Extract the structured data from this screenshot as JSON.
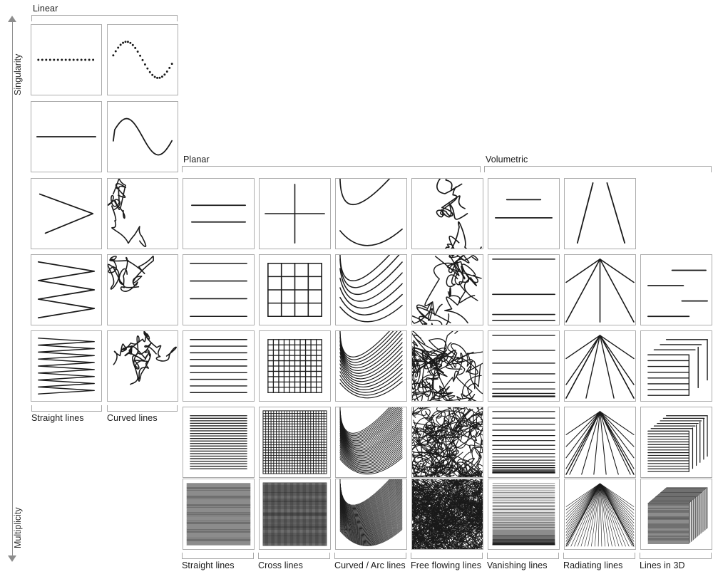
{
  "figure": {
    "title_axes": {
      "vertical_top": "Singularity",
      "vertical_bottom": "Multiplicity"
    },
    "top_groups": [
      {
        "id": "linear",
        "label": "Linear",
        "columns": [
          0,
          1
        ]
      },
      {
        "id": "planar",
        "label": "Planar",
        "columns": [
          2,
          3,
          4,
          5
        ]
      },
      {
        "id": "volumetric",
        "label": "Volumetric",
        "columns": [
          6,
          7,
          8
        ]
      }
    ],
    "column_labels_upper": [
      "Straight lines",
      "Curved lines"
    ],
    "column_labels_lower": [
      "Straight lines",
      "Cross lines",
      "Curved / Arc lines",
      "Free flowing lines",
      "Vanishing lines",
      "Radiating lines",
      "Lines in  3D"
    ],
    "colors": {
      "cell_border": "#acacac",
      "bracket": "#a8a8a8",
      "axis": "#8d8d8d",
      "stroke": "#1a1a1a",
      "text": "#1a1a1a",
      "background": "#ffffff"
    },
    "grid": {
      "columns": 9,
      "rows": 8,
      "linear_column_rows": [
        0,
        1,
        2,
        3,
        4
      ],
      "planar_column_rows": [
        2,
        3,
        4,
        5,
        6,
        7
      ],
      "volumetric_column_rows": [
        2,
        3,
        4,
        5,
        6,
        7
      ],
      "lines_in_3d_rows": [
        3,
        4,
        5,
        6,
        7
      ]
    },
    "cells": {
      "col0": {
        "name": "straight-lines-linear",
        "rows": [
          "dotted-straight",
          "single-straight",
          "zigzag-1",
          "zigzag-2",
          "zigzag-3"
        ]
      },
      "col1": {
        "name": "curved-lines-linear",
        "rows": [
          "dotted-wave",
          "single-wave",
          "squiggle-1",
          "squiggle-2",
          "squiggle-3"
        ]
      },
      "col2": {
        "name": "straight-lines-planar",
        "rows": [
          "parallel-2",
          "parallel-4",
          "parallel-8",
          "parallel-20",
          "parallel-40",
          "parallel-70"
        ]
      },
      "col3": {
        "name": "cross-lines-planar",
        "rows": [
          "cross-1",
          "grid-4",
          "grid-10",
          "grid-24",
          "grid-44",
          "grid-70"
        ]
      },
      "col4": {
        "name": "curved-arc-lines-planar",
        "rows": [
          "arc-2",
          "arc-6",
          "arc-14",
          "arc-30",
          "arc-55",
          "arc-90"
        ]
      },
      "col5": {
        "name": "free-flowing-lines-planar",
        "rows": [
          "flow-3",
          "flow-10",
          "flow-24",
          "flow-50",
          "flow-90",
          "flow-160"
        ]
      },
      "col6": {
        "name": "vanishing-lines-volumetric",
        "rows": [
          "vanish-2",
          "vanish-4",
          "vanish-8",
          "vanish-18",
          "vanish-34",
          "vanish-60"
        ]
      },
      "col7": {
        "name": "radiating-lines-volumetric",
        "rows": [
          "radiate-2",
          "radiate-4",
          "radiate-10",
          "radiate-22",
          "radiate-44",
          "radiate-80"
        ]
      },
      "col8": {
        "name": "lines-in-3d-volumetric",
        "rows": [
          "box3d-4",
          "box3d-12",
          "box3d-26",
          "box3d-50",
          "box3d-90"
        ]
      }
    }
  }
}
